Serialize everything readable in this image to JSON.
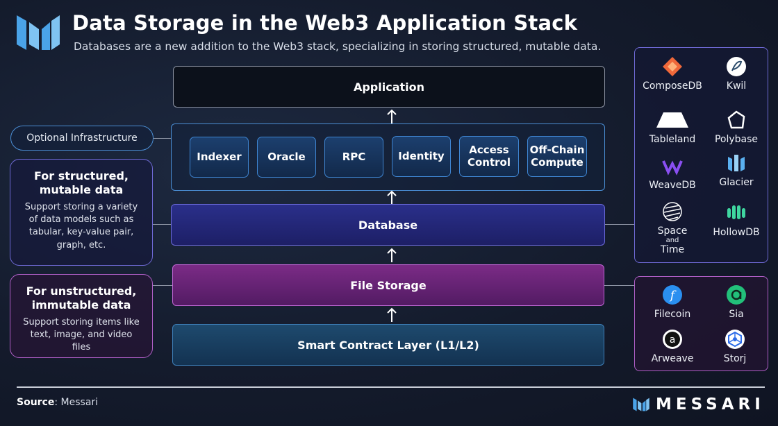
{
  "header": {
    "title": "Data Storage in the Web3 Application Stack",
    "subtitle": "Databases are a new addition to the Web3 stack, specializing in storing structured, mutable data."
  },
  "stack": {
    "application": "Application",
    "optional_chips": [
      "Indexer",
      "Oracle",
      "RPC",
      "Identity",
      "Access Control",
      "Off-Chain Compute"
    ],
    "database": "Database",
    "file_storage": "File Storage",
    "smart_contract": "Smart Contract Layer (L1/L2)"
  },
  "left": {
    "optional_label": "Optional Infrastructure",
    "structured": {
      "heading": "For structured, mutable data",
      "body": "Support storing a variety of data models such as tabular, key-value pair, graph, etc."
    },
    "unstructured": {
      "heading": "For unstructured, immutable data",
      "body": "Support storing items like text, image, and video files"
    }
  },
  "right": {
    "databases": [
      {
        "name": "ComposeDB",
        "icon": "composedb-icon",
        "color": "#f0683a"
      },
      {
        "name": "Kwil",
        "icon": "kwil-icon",
        "color": "#ffffff"
      },
      {
        "name": "Tableland",
        "icon": "tableland-icon",
        "color": "#ffffff"
      },
      {
        "name": "Polybase",
        "icon": "polybase-icon",
        "color": "#ffffff"
      },
      {
        "name": "WeaveDB",
        "icon": "weavedb-icon",
        "color": "#8a4ff2"
      },
      {
        "name": "Glacier",
        "icon": "glacier-icon",
        "color": "#5ab0f0"
      },
      {
        "name": "Space\nand\nTime",
        "icon": "space-and-time-icon",
        "color": "#ffffff"
      },
      {
        "name": "HollowDB",
        "icon": "hollowdb-icon",
        "color": "#3fd6a0"
      }
    ],
    "file_storage": [
      {
        "name": "Filecoin",
        "icon": "filecoin-icon",
        "color": "#2a8ff0"
      },
      {
        "name": "Sia",
        "icon": "sia-icon",
        "color": "#22c07a"
      },
      {
        "name": "Arweave",
        "icon": "arweave-icon",
        "color": "#ffffff"
      },
      {
        "name": "Storj",
        "icon": "storj-icon",
        "color": "#2d6be8"
      }
    ]
  },
  "footer": {
    "source_label": "Source",
    "source_value": ": Messari",
    "brand": "MESSARI"
  },
  "colors": {
    "background": "#141b2c",
    "structured_accent": "#6f6ad6",
    "unstructured_accent": "#b05fc7",
    "infra_accent": "#4b8fd6"
  }
}
